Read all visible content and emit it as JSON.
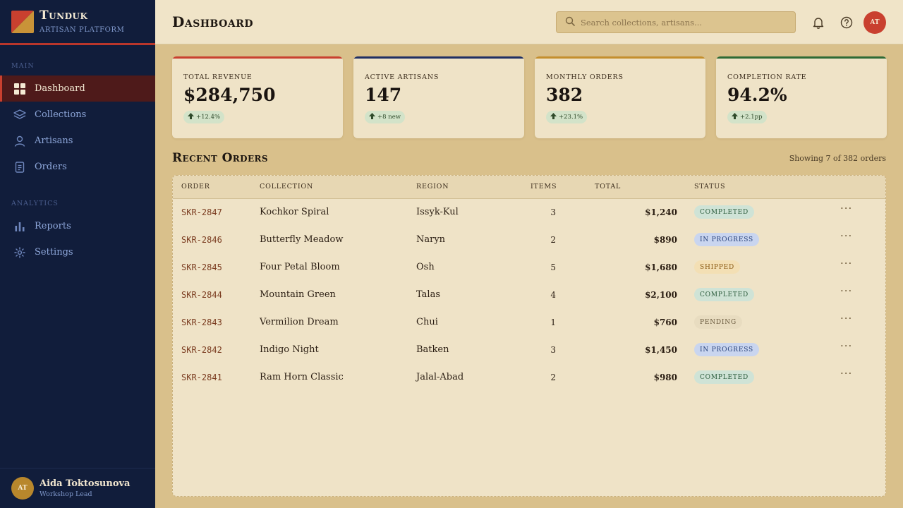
{
  "brand": {
    "name": "Tunduk",
    "subtitle": "Artisan Platform"
  },
  "sidebar": {
    "sections": [
      {
        "label": "Main"
      },
      {
        "label": "Analytics"
      }
    ],
    "items": [
      {
        "label": "Dashboard",
        "icon": "grid-icon",
        "active": true
      },
      {
        "label": "Collections",
        "icon": "layers-icon"
      },
      {
        "label": "Artisans",
        "icon": "user-icon"
      },
      {
        "label": "Orders",
        "icon": "document-icon"
      },
      {
        "label": "Reports",
        "icon": "bar-chart-icon"
      },
      {
        "label": "Settings",
        "icon": "gear-icon"
      }
    ]
  },
  "user": {
    "initials": "AT",
    "name": "Aida Toktosunova",
    "role": "Workshop Lead"
  },
  "header": {
    "title": "Dashboard",
    "search_placeholder": "Search collections, artisans...",
    "avatar_initials": "AT"
  },
  "stats": [
    {
      "label": "Total Revenue",
      "value": "$284,750",
      "delta": "+12.4%",
      "accent": "#c9402f"
    },
    {
      "label": "Active Artisans",
      "value": "147",
      "delta": "+8 new",
      "accent": "#1f2f63"
    },
    {
      "label": "Monthly Orders",
      "value": "382",
      "delta": "+23.1%",
      "accent": "#c48f2e"
    },
    {
      "label": "Completion Rate",
      "value": "94.2%",
      "delta": "+2.1pp",
      "accent": "#2f6a35"
    }
  ],
  "orders": {
    "title": "Recent Orders",
    "showing": "Showing 7 of 382 orders",
    "columns": [
      "Order",
      "Collection",
      "Region",
      "Items",
      "Total",
      "Status"
    ],
    "rows": [
      {
        "order": "SKR-2847",
        "collection": "Kochkor Spiral",
        "region": "Issyk-Kul",
        "items": "3",
        "total": "$1,240",
        "status": "Completed"
      },
      {
        "order": "SKR-2846",
        "collection": "Butterfly Meadow",
        "region": "Naryn",
        "items": "2",
        "total": "$890",
        "status": "In Progress"
      },
      {
        "order": "SKR-2845",
        "collection": "Four Petal Bloom",
        "region": "Osh",
        "items": "5",
        "total": "$1,680",
        "status": "Shipped"
      },
      {
        "order": "SKR-2844",
        "collection": "Mountain Green",
        "region": "Talas",
        "items": "4",
        "total": "$2,100",
        "status": "Completed"
      },
      {
        "order": "SKR-2843",
        "collection": "Vermilion Dream",
        "region": "Chui",
        "items": "1",
        "total": "$760",
        "status": "Pending"
      },
      {
        "order": "SKR-2842",
        "collection": "Indigo Night",
        "region": "Batken",
        "items": "3",
        "total": "$1,450",
        "status": "In Progress"
      },
      {
        "order": "SKR-2841",
        "collection": "Ram Horn Classic",
        "region": "Jalal-Abad",
        "items": "2",
        "total": "$980",
        "status": "Completed"
      }
    ],
    "status_colors": {
      "Completed": {
        "bg": "#cfe3d6",
        "fg": "#2a5a3b"
      },
      "In Progress": {
        "bg": "#c9d5ef",
        "fg": "#26407a"
      },
      "Shipped": {
        "bg": "#f3dfb4",
        "fg": "#8a5a14"
      },
      "Pending": {
        "bg": "#e8dcc0",
        "fg": "#6a5a3e"
      }
    }
  },
  "colors": {
    "sidebar": "#111d3b",
    "accent_red": "#c9402f",
    "background": "#d9c08b"
  }
}
